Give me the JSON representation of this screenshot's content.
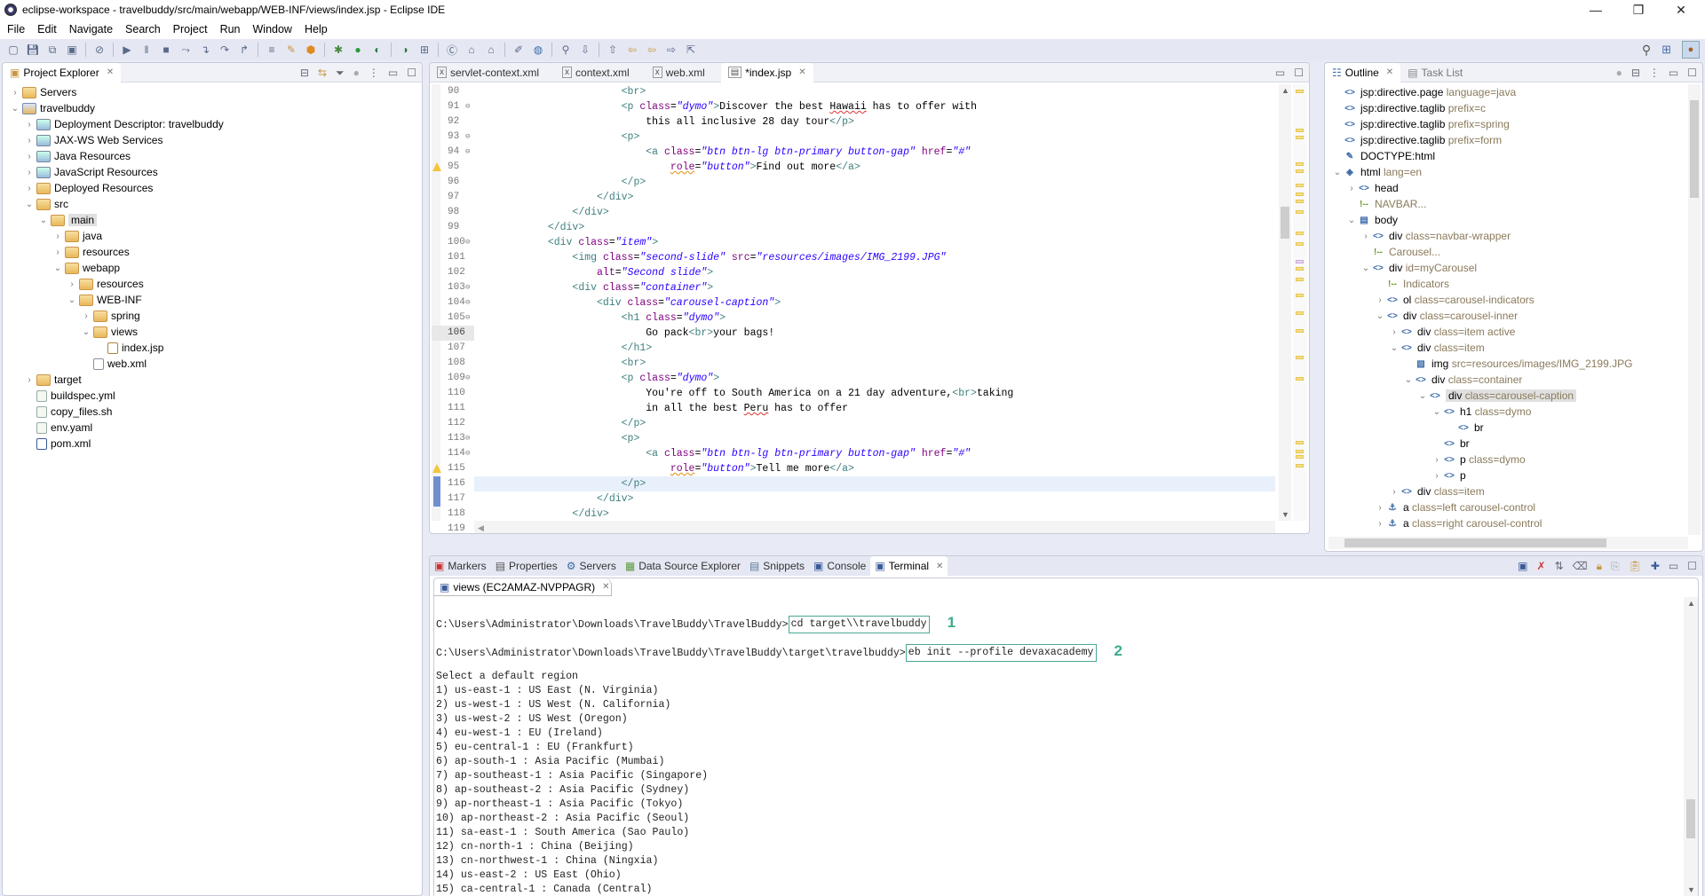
{
  "window": {
    "title": "eclipse-workspace - travelbuddy/src/main/webapp/WEB-INF/views/index.jsp - Eclipse IDE",
    "controls": {
      "minimize": "—",
      "restore": "❐",
      "close": "✕"
    }
  },
  "menu": [
    "File",
    "Edit",
    "Navigate",
    "Search",
    "Project",
    "Run",
    "Window",
    "Help"
  ],
  "toolbar": {
    "icons": [
      "new-icon",
      "save-icon",
      "save-all-icon",
      "terminal-icon",
      "skip-breakpoints-icon",
      "resume-icon",
      "suspend-icon",
      "terminate-icon",
      "disconnect-icon",
      "step-into-icon",
      "step-over-icon",
      "step-return-icon",
      "toggle-mark-icon",
      "wizard-icon",
      "package-icon",
      "debug-icon",
      "run-icon",
      "run-coverage-icon",
      "run-external-icon",
      "new-server-icon",
      "new-class-icon",
      "open-type-icon",
      "open-task-icon",
      "annotation-icon",
      "web-browser-icon",
      "search-icon",
      "next-annotation-icon",
      "prev-annotation-icon",
      "last-edit-icon",
      "back-icon",
      "forward-icon",
      "pin-editor-icon"
    ],
    "right_icons": [
      "search-icon",
      "open-perspective-icon",
      "java-ee-perspective-icon"
    ]
  },
  "project_explorer": {
    "title": "Project Explorer",
    "tree": [
      {
        "label": "Servers",
        "depth": 0,
        "twisty": ">",
        "icon": "folder"
      },
      {
        "label": "travelbuddy",
        "depth": 0,
        "twisty": "v",
        "icon": "project"
      },
      {
        "label": "Deployment Descriptor: travelbuddy",
        "depth": 1,
        "twisty": ">",
        "icon": "misc"
      },
      {
        "label": "JAX-WS Web Services",
        "depth": 1,
        "twisty": ">",
        "icon": "misc"
      },
      {
        "label": "Java Resources",
        "depth": 1,
        "twisty": ">",
        "icon": "misc"
      },
      {
        "label": "JavaScript Resources",
        "depth": 1,
        "twisty": ">",
        "icon": "misc"
      },
      {
        "label": "Deployed Resources",
        "depth": 1,
        "twisty": ">",
        "icon": "folder"
      },
      {
        "label": "src",
        "depth": 1,
        "twisty": "v",
        "icon": "folder"
      },
      {
        "label": "main",
        "depth": 2,
        "twisty": "v",
        "icon": "folder",
        "selected": true
      },
      {
        "label": "java",
        "depth": 3,
        "twisty": ">",
        "icon": "folder"
      },
      {
        "label": "resources",
        "depth": 3,
        "twisty": ">",
        "icon": "folder"
      },
      {
        "label": "webapp",
        "depth": 3,
        "twisty": "v",
        "icon": "folder"
      },
      {
        "label": "resources",
        "depth": 4,
        "twisty": ">",
        "icon": "folder"
      },
      {
        "label": "WEB-INF",
        "depth": 4,
        "twisty": "v",
        "icon": "folder"
      },
      {
        "label": "spring",
        "depth": 5,
        "twisty": ">",
        "icon": "folder"
      },
      {
        "label": "views",
        "depth": 5,
        "twisty": "v",
        "icon": "folder"
      },
      {
        "label": "index.jsp",
        "depth": 6,
        "twisty": "",
        "icon": "jsp"
      },
      {
        "label": "web.xml",
        "depth": 5,
        "twisty": "",
        "icon": "xml"
      },
      {
        "label": "target",
        "depth": 1,
        "twisty": ">",
        "icon": "folder"
      },
      {
        "label": "buildspec.yml",
        "depth": 1,
        "twisty": "",
        "icon": "file"
      },
      {
        "label": "copy_files.sh",
        "depth": 1,
        "twisty": "",
        "icon": "file"
      },
      {
        "label": "env.yaml",
        "depth": 1,
        "twisty": "",
        "icon": "file"
      },
      {
        "label": "pom.xml",
        "depth": 1,
        "twisty": "",
        "icon": "pom"
      }
    ]
  },
  "editor": {
    "tabs": [
      {
        "label": "servlet-context.xml",
        "active": false
      },
      {
        "label": "context.xml",
        "active": false
      },
      {
        "label": "web.xml",
        "active": false
      },
      {
        "label": "*index.jsp",
        "active": true
      }
    ],
    "lines": [
      {
        "n": "90",
        "fold": false,
        "warn": false,
        "html": "                        <span class='tag'>&lt;br&gt;</span>"
      },
      {
        "n": "91",
        "fold": true,
        "warn": false,
        "html": "                        <span class='tag'>&lt;p</span> <span class='attr'>class</span>=<span class='val'>\"dymo\"</span><span class='tag'>&gt;</span>Discover the best <span class='sq'>Hawaii</span> has to offer with"
      },
      {
        "n": "92",
        "fold": false,
        "warn": false,
        "html": "                            this all inclusive 28 day tour<span class='tag'>&lt;/p&gt;</span>"
      },
      {
        "n": "93",
        "fold": true,
        "warn": false,
        "html": "                        <span class='tag'>&lt;p&gt;</span>"
      },
      {
        "n": "94",
        "fold": true,
        "warn": false,
        "html": "                            <span class='tag'>&lt;a</span> <span class='attr'>class</span>=<span class='val'>\"btn btn-lg btn-primary button-gap\"</span> <span class='attr'>href</span>=<span class='val'>\"#\"</span>"
      },
      {
        "n": "95",
        "fold": false,
        "warn": true,
        "html": "                                <span class='attr wq'>role</span>=<span class='val'>\"button\"</span><span class='tag'>&gt;</span>Find out more<span class='tag'>&lt;/a&gt;</span>"
      },
      {
        "n": "96",
        "fold": false,
        "warn": false,
        "html": "                        <span class='tag'>&lt;/p&gt;</span>"
      },
      {
        "n": "97",
        "fold": false,
        "warn": false,
        "html": "                    <span class='tag'>&lt;/div&gt;</span>"
      },
      {
        "n": "98",
        "fold": false,
        "warn": false,
        "html": "                <span class='tag'>&lt;/div&gt;</span>"
      },
      {
        "n": "99",
        "fold": false,
        "warn": false,
        "html": "            <span class='tag'>&lt;/div&gt;</span>"
      },
      {
        "n": "100",
        "fold": true,
        "warn": false,
        "html": "            <span class='tag'>&lt;div</span> <span class='attr'>class</span>=<span class='val'>\"item\"</span><span class='tag'>&gt;</span>"
      },
      {
        "n": "101",
        "fold": false,
        "warn": false,
        "html": "                <span class='tag'>&lt;img</span> <span class='attr'>class</span>=<span class='val'>\"second-slide\"</span> <span class='attr'>src</span>=<span class='val'>\"resources/images/IMG_2199.JPG\"</span>"
      },
      {
        "n": "102",
        "fold": false,
        "warn": false,
        "html": "                    <span class='attr'>alt</span>=<span class='val'>\"Second slide\"</span><span class='tag'>&gt;</span>"
      },
      {
        "n": "103",
        "fold": true,
        "warn": false,
        "html": "                <span class='tag'>&lt;div</span> <span class='attr'>class</span>=<span class='val'>\"container\"</span><span class='tag'>&gt;</span>"
      },
      {
        "n": "104",
        "fold": true,
        "warn": false,
        "html": "                    <span class='tag'>&lt;div</span> <span class='attr'>class</span>=<span class='val'>\"carousel-caption\"</span><span class='tag'>&gt;</span>"
      },
      {
        "n": "105",
        "fold": true,
        "warn": false,
        "html": "                        <span class='tag'>&lt;h1</span> <span class='attr'>class</span>=<span class='val'>\"dymo\"</span><span class='tag'>&gt;</span>"
      },
      {
        "n": "106",
        "fold": false,
        "warn": false,
        "cur": true,
        "html": "                            Go pack<span class='tag'>&lt;br&gt;</span>your bags!"
      },
      {
        "n": "107",
        "fold": false,
        "warn": false,
        "html": "                        <span class='tag'>&lt;/h1&gt;</span>"
      },
      {
        "n": "108",
        "fold": false,
        "warn": false,
        "html": "                        <span class='tag'>&lt;br&gt;</span>"
      },
      {
        "n": "109",
        "fold": true,
        "warn": false,
        "html": "                        <span class='tag'>&lt;p</span> <span class='attr'>class</span>=<span class='val'>\"dymo\"</span><span class='tag'>&gt;</span>"
      },
      {
        "n": "110",
        "fold": false,
        "warn": false,
        "html": "                            You're off to South America on a 21 day adventure,<span class='tag'>&lt;br&gt;</span>taking"
      },
      {
        "n": "111",
        "fold": false,
        "warn": false,
        "html": "                            in all the best <span class='sq'>Peru</span> has to offer"
      },
      {
        "n": "112",
        "fold": false,
        "warn": false,
        "html": "                        <span class='tag'>&lt;/p&gt;</span>"
      },
      {
        "n": "113",
        "fold": true,
        "warn": false,
        "html": "                        <span class='tag'>&lt;p&gt;</span>"
      },
      {
        "n": "114",
        "fold": true,
        "warn": false,
        "html": "                            <span class='tag'>&lt;a</span> <span class='attr'>class</span>=<span class='val'>\"btn btn-lg btn-primary button-gap\"</span> <span class='attr'>href</span>=<span class='val'>\"#\"</span>"
      },
      {
        "n": "115",
        "fold": false,
        "warn": true,
        "html": "                                <span class='attr wq'>role</span>=<span class='val'>\"button\"</span><span class='tag'>&gt;</span>Tell me more<span class='tag'>&lt;/a&gt;</span>"
      },
      {
        "n": "116",
        "fold": false,
        "warn": false,
        "mark": true,
        "hl": true,
        "html": "                        <span class='tag'>&lt;/p&gt;</span>"
      },
      {
        "n": "117",
        "fold": false,
        "warn": false,
        "mark": true,
        "html": "                    <span class='tag'>&lt;/div&gt;</span>"
      },
      {
        "n": "118",
        "fold": false,
        "warn": false,
        "html": "                <span class='tag'>&lt;/div&gt;</span>"
      },
      {
        "n": "119",
        "fold": false,
        "warn": false,
        "html": "            <span class='tag'>&lt;/div&gt;</span>"
      }
    ]
  },
  "outline": {
    "tabs": [
      {
        "label": "Outline",
        "active": true
      },
      {
        "label": "Task List",
        "active": false
      }
    ],
    "tree": [
      {
        "depth": 0,
        "twisty": "",
        "icon": "tag",
        "name": "jsp:directive.page",
        "attr": "language=java"
      },
      {
        "depth": 0,
        "twisty": "",
        "icon": "tag",
        "name": "jsp:directive.taglib",
        "attr": "prefix=c"
      },
      {
        "depth": 0,
        "twisty": "",
        "icon": "tag",
        "name": "jsp:directive.taglib",
        "attr": "prefix=spring"
      },
      {
        "depth": 0,
        "twisty": "",
        "icon": "tag",
        "name": "jsp:directive.taglib",
        "attr": "prefix=form"
      },
      {
        "depth": 0,
        "twisty": "",
        "icon": "doctype",
        "name": "DOCTYPE:html",
        "attr": ""
      },
      {
        "depth": 0,
        "twisty": "v",
        "icon": "html",
        "name": "html",
        "attr": "lang=en"
      },
      {
        "depth": 1,
        "twisty": ">",
        "icon": "tag",
        "name": "head",
        "attr": ""
      },
      {
        "depth": 1,
        "twisty": "",
        "icon": "comment",
        "name": "",
        "attr": "NAVBAR..."
      },
      {
        "depth": 1,
        "twisty": "v",
        "icon": "body",
        "name": "body",
        "attr": ""
      },
      {
        "depth": 2,
        "twisty": ">",
        "icon": "tag",
        "name": "div",
        "attr": "class=navbar-wrapper"
      },
      {
        "depth": 2,
        "twisty": "",
        "icon": "comment",
        "name": "",
        "attr": "Carousel..."
      },
      {
        "depth": 2,
        "twisty": "v",
        "icon": "tag",
        "name": "div",
        "attr": "id=myCarousel"
      },
      {
        "depth": 3,
        "twisty": "",
        "icon": "comment",
        "name": "",
        "attr": "Indicators"
      },
      {
        "depth": 3,
        "twisty": ">",
        "icon": "tag",
        "name": "ol",
        "attr": "class=carousel-indicators"
      },
      {
        "depth": 3,
        "twisty": "v",
        "icon": "tag",
        "name": "div",
        "attr": "class=carousel-inner"
      },
      {
        "depth": 4,
        "twisty": ">",
        "icon": "tag",
        "name": "div",
        "attr": "class=item active"
      },
      {
        "depth": 4,
        "twisty": "v",
        "icon": "tag",
        "name": "div",
        "attr": "class=item"
      },
      {
        "depth": 5,
        "twisty": "",
        "icon": "img",
        "name": "img",
        "attr": "src=resources/images/IMG_2199.JPG"
      },
      {
        "depth": 5,
        "twisty": "v",
        "icon": "tag",
        "name": "div",
        "attr": "class=container"
      },
      {
        "depth": 6,
        "twisty": "v",
        "icon": "tag",
        "name": "div",
        "attr": "class=carousel-caption",
        "selected": true
      },
      {
        "depth": 7,
        "twisty": "v",
        "icon": "tag",
        "name": "h1",
        "attr": "class=dymo"
      },
      {
        "depth": 8,
        "twisty": "",
        "icon": "tag",
        "name": "br",
        "attr": ""
      },
      {
        "depth": 7,
        "twisty": "",
        "icon": "tag",
        "name": "br",
        "attr": ""
      },
      {
        "depth": 7,
        "twisty": ">",
        "icon": "tag",
        "name": "p",
        "attr": "class=dymo"
      },
      {
        "depth": 7,
        "twisty": ">",
        "icon": "tag",
        "name": "p",
        "attr": ""
      },
      {
        "depth": 4,
        "twisty": ">",
        "icon": "tag",
        "name": "div",
        "attr": "class=item"
      },
      {
        "depth": 3,
        "twisty": ">",
        "icon": "anchor",
        "name": "a",
        "attr": "class=left carousel-control"
      },
      {
        "depth": 3,
        "twisty": ">",
        "icon": "anchor",
        "name": "a",
        "attr": "class=right carousel-control"
      }
    ]
  },
  "bottom_panel": {
    "tabs": [
      {
        "label": "Markers",
        "active": false
      },
      {
        "label": "Properties",
        "active": false
      },
      {
        "label": "Servers",
        "active": false
      },
      {
        "label": "Data Source Explorer",
        "active": false
      },
      {
        "label": "Snippets",
        "active": false
      },
      {
        "label": "Console",
        "active": false
      },
      {
        "label": "Terminal",
        "active": true
      }
    ],
    "terminal_tab": "views (EC2AMAZ-NVPPAGR)",
    "terminal": {
      "cmd1_prompt": "C:\\Users\\Administrator\\Downloads\\TravelBuddy\\TravelBuddy>",
      "cmd1": "cd target\\\\travelbuddy",
      "cmd1_callout": "1",
      "cmd2_prompt": "C:\\Users\\Administrator\\Downloads\\TravelBuddy\\TravelBuddy\\target\\travelbuddy>",
      "cmd2": "eb init --profile devaxacademy",
      "cmd2_callout": "2",
      "heading": "Select a default region",
      "regions": [
        "1) us-east-1 : US East (N. Virginia)",
        "2) us-west-1 : US West (N. California)",
        "3) us-west-2 : US West (Oregon)",
        "4) eu-west-1 : EU (Ireland)",
        "5) eu-central-1 : EU (Frankfurt)",
        "6) ap-south-1 : Asia Pacific (Mumbai)",
        "7) ap-southeast-1 : Asia Pacific (Singapore)",
        "8) ap-southeast-2 : Asia Pacific (Sydney)",
        "9) ap-northeast-1 : Asia Pacific (Tokyo)",
        "10) ap-northeast-2 : Asia Pacific (Seoul)",
        "11) sa-east-1 : South America (Sao Paulo)",
        "12) cn-north-1 : China (Beijing)",
        "13) cn-northwest-1 : China (Ningxia)",
        "14) us-east-2 : US East (Ohio)",
        "15) ca-central-1 : Canada (Central)"
      ]
    }
  },
  "colors": {
    "callout": "#3cab8d",
    "highlight_box": "#4aa894",
    "tag": "#3f7f7f",
    "attr": "#7f007f",
    "value": "#2a00ff"
  }
}
